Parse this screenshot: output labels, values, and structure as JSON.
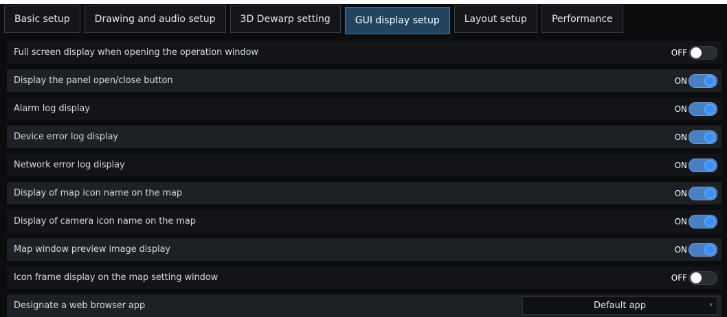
{
  "tabs": [
    {
      "label": "Basic setup",
      "active": false
    },
    {
      "label": "Drawing and audio setup",
      "active": false
    },
    {
      "label": "3D Dewarp setting",
      "active": false
    },
    {
      "label": "GUI display setup",
      "active": true
    },
    {
      "label": "Layout setup",
      "active": false
    },
    {
      "label": "Performance",
      "active": false
    }
  ],
  "settings": [
    {
      "label": "Full screen display when opening the operation window",
      "state": "OFF"
    },
    {
      "label": "Display the panel open/close button",
      "state": "ON"
    },
    {
      "label": "Alarm log display",
      "state": "ON"
    },
    {
      "label": "Device error log display",
      "state": "ON"
    },
    {
      "label": "Network error log display",
      "state": "ON"
    },
    {
      "label": "Display of map icon name on the map",
      "state": "ON"
    },
    {
      "label": "Display of camera icon name on the map",
      "state": "ON"
    },
    {
      "label": "Map window preview image display",
      "state": "ON"
    },
    {
      "label": "Icon frame display on the map setting window",
      "state": "OFF"
    }
  ],
  "browser": {
    "label": "Designate a web browser app",
    "value": "Default app"
  },
  "colors": {
    "active_tab": "#23435f",
    "toggle_on": "#4a7fc1",
    "toggle_off": "#2a2d31"
  }
}
